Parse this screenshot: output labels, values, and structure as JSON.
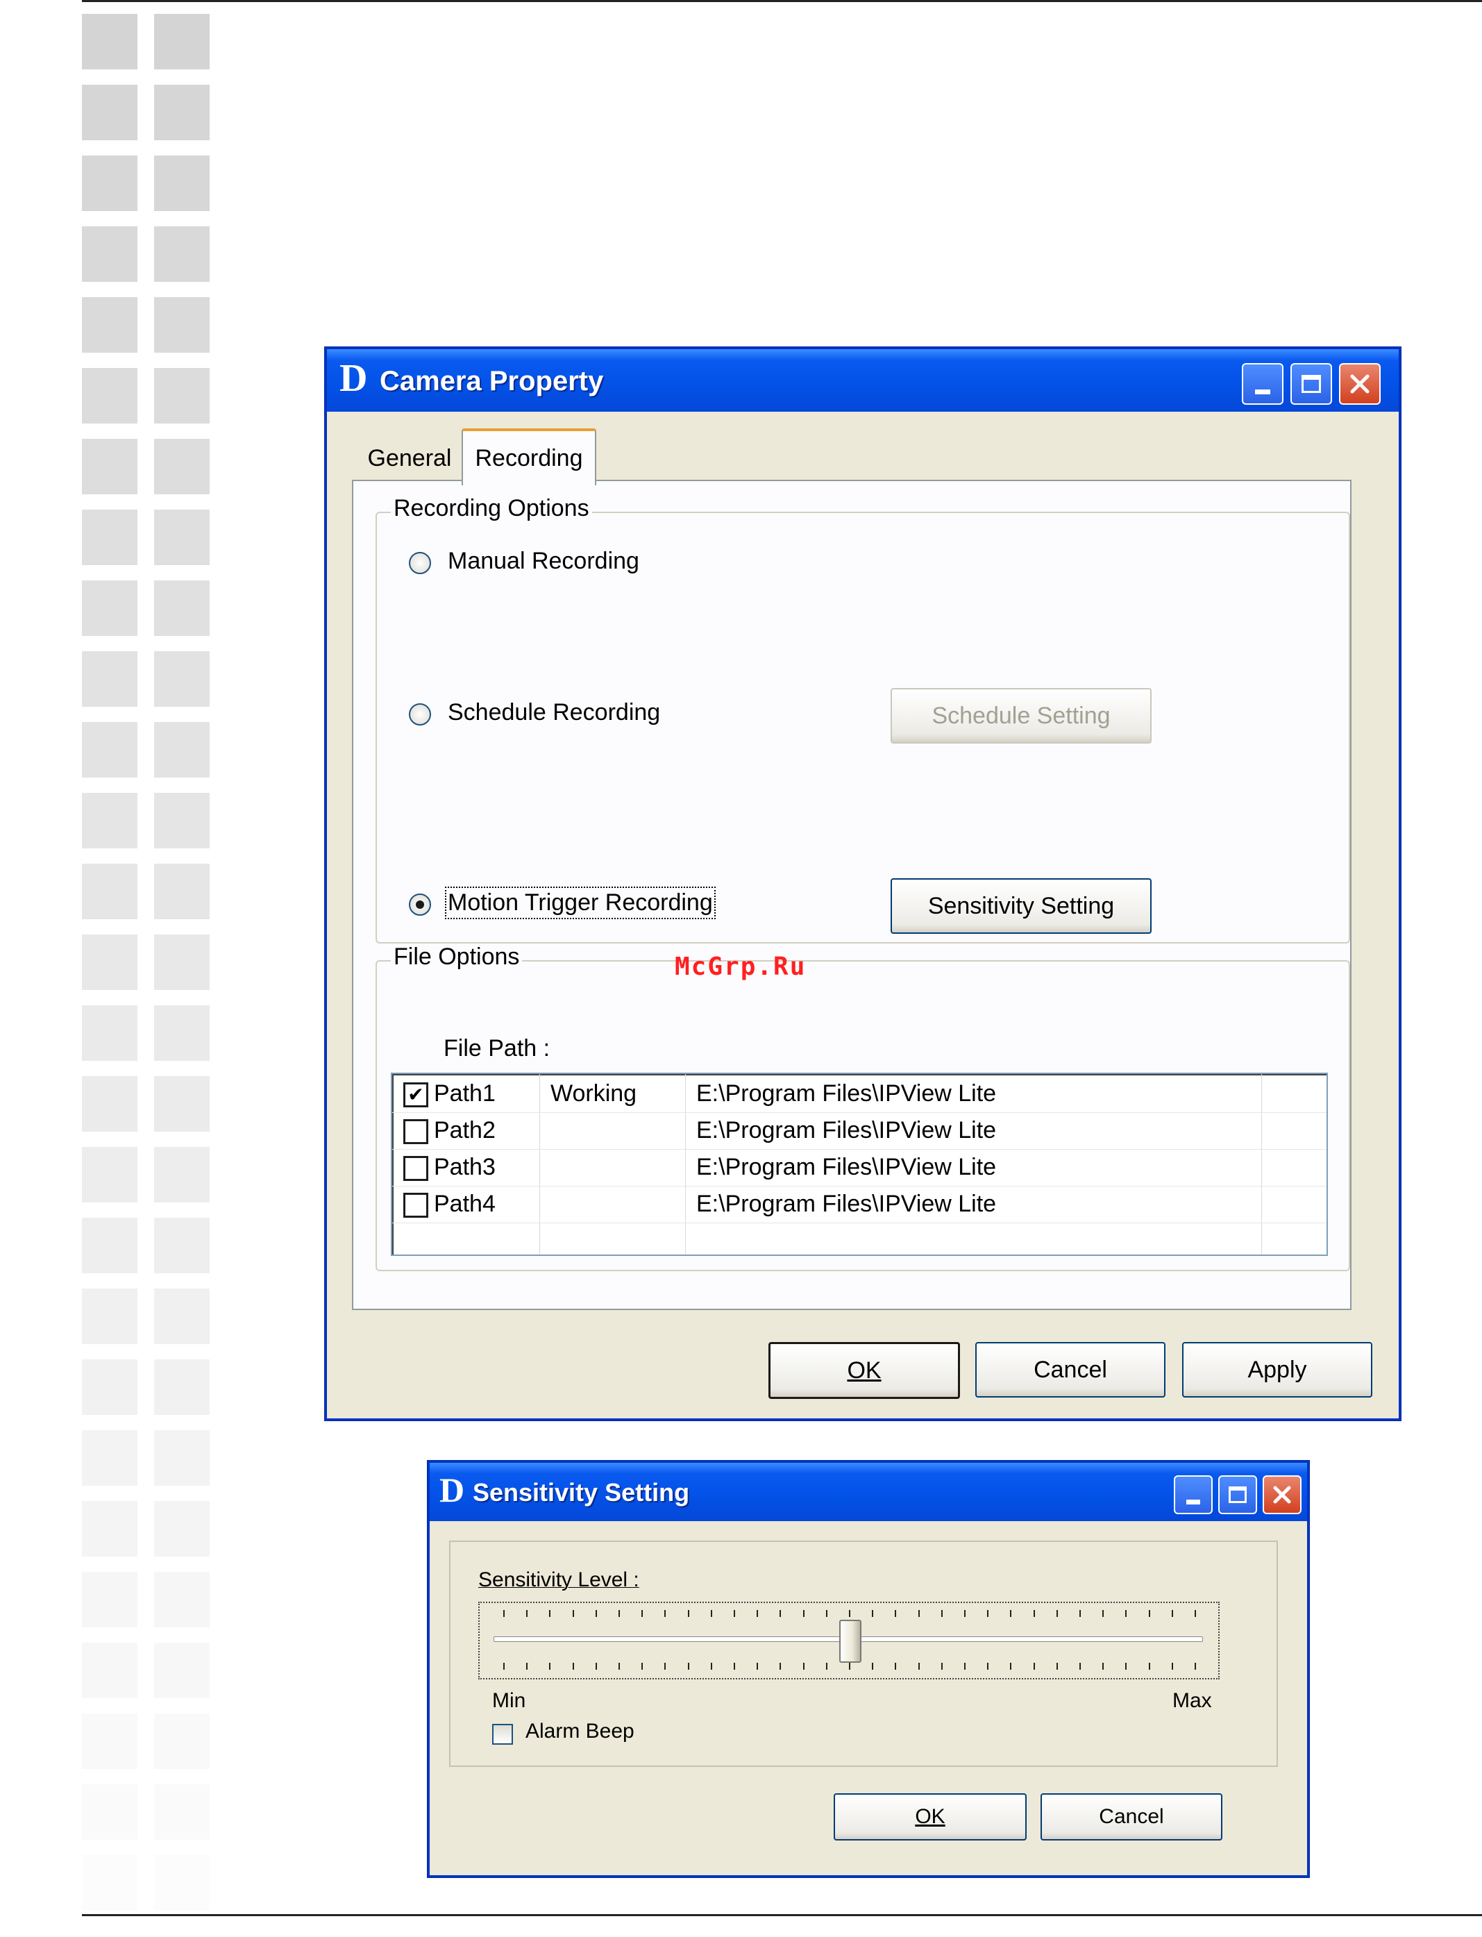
{
  "camera_property": {
    "title": "Camera Property",
    "logo": "D",
    "tabs": [
      {
        "label": "General",
        "selected": false
      },
      {
        "label": "Recording",
        "selected": true
      }
    ],
    "recording_options": {
      "legend": "Recording Options",
      "manual": "Manual Recording",
      "schedule": "Schedule Recording",
      "motion": "Motion Trigger Recording",
      "selected": "motion",
      "schedule_button": "Schedule Setting",
      "sensitivity_button": "Sensitivity Setting"
    },
    "file_options": {
      "legend": "File Options",
      "file_path_label": "File Path  :",
      "rows": [
        {
          "name": "Path1",
          "status": "Working",
          "path": "E:\\Program Files\\IPView Lite",
          "checked": true
        },
        {
          "name": "Path2",
          "status": "",
          "path": "E:\\Program Files\\IPView Lite",
          "checked": false
        },
        {
          "name": "Path3",
          "status": "",
          "path": "E:\\Program Files\\IPView Lite",
          "checked": false
        },
        {
          "name": "Path4",
          "status": "",
          "path": "E:\\Program Files\\IPView Lite",
          "checked": false
        }
      ]
    },
    "buttons": {
      "ok": "OK",
      "cancel": "Cancel",
      "apply": "Apply"
    }
  },
  "sensitivity_setting": {
    "title": "Sensitivity Setting",
    "logo": "D",
    "level_label": "Sensitivity Level :",
    "min_label": "Min",
    "max_label": "Max",
    "slider_value": 0.5,
    "alarm_beep_label": "Alarm Beep",
    "alarm_beep_checked": false,
    "buttons": {
      "ok": "OK",
      "cancel": "Cancel"
    }
  },
  "watermark": "McGrp.Ru",
  "colors": {
    "titlebar": "#0351e6",
    "dialog_face": "#ece9d8",
    "close_button": "#d2401f",
    "watermark": "#ff2020"
  }
}
